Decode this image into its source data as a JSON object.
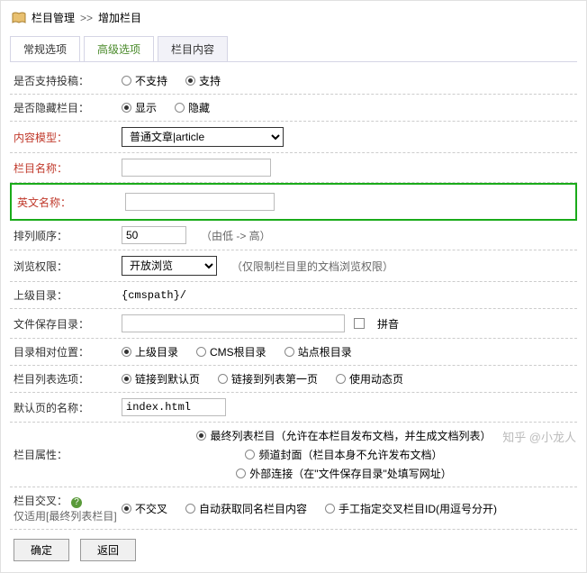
{
  "breadcrumb": {
    "section": "栏目管理",
    "sep": ">>",
    "page": "增加栏目"
  },
  "tabs": {
    "t0": "常规选项",
    "t1": "高级选项",
    "t2": "栏目内容"
  },
  "form": {
    "support_submit": {
      "label": "是否支持投稿：",
      "opt_no": "不支持",
      "opt_yes": "支持"
    },
    "hidden": {
      "label": "是否隐藏栏目：",
      "opt_show": "显示",
      "opt_hide": "隐藏"
    },
    "model": {
      "label": "内容模型：",
      "value": "普通文章|article"
    },
    "name": {
      "label": "栏目名称："
    },
    "ename": {
      "label": "英文名称："
    },
    "order": {
      "label": "排列顺序：",
      "value": "50",
      "hint": "（由低 -> 高）"
    },
    "browse": {
      "label": "浏览权限：",
      "value": "开放浏览",
      "hint": "（仅限制栏目里的文档浏览权限）"
    },
    "parent": {
      "label": "上级目录：",
      "value": "{cmspath}/"
    },
    "save_dir": {
      "label": "文件保存目录：",
      "pinyin": "拼音"
    },
    "rel_pos": {
      "label": "目录相对位置：",
      "o1": "上级目录",
      "o2": "CMS根目录",
      "o3": "站点根目录"
    },
    "list_opt": {
      "label": "栏目列表选项：",
      "o1": "链接到默认页",
      "o2": "链接到列表第一页",
      "o3": "使用动态页"
    },
    "default_page": {
      "label": "默认页的名称：",
      "value": "index.html"
    },
    "attr": {
      "label": "栏目属性：",
      "o1": "最终列表栏目（允许在本栏目发布文档，并生成文档列表）",
      "o2": "频道封面（栏目本身不允许发布文档）",
      "o3": "外部连接（在\"文件保存目录\"处填写网址）"
    },
    "cross": {
      "label": "栏目交叉：",
      "sub": "仅适用[最终列表栏目]",
      "o1": "不交叉",
      "o2": "自动获取同名栏目内容",
      "o3": "手工指定交叉栏目ID(用逗号分开)"
    }
  },
  "buttons": {
    "ok": "确定",
    "back": "返回"
  },
  "watermark": "知乎 @小龙人"
}
